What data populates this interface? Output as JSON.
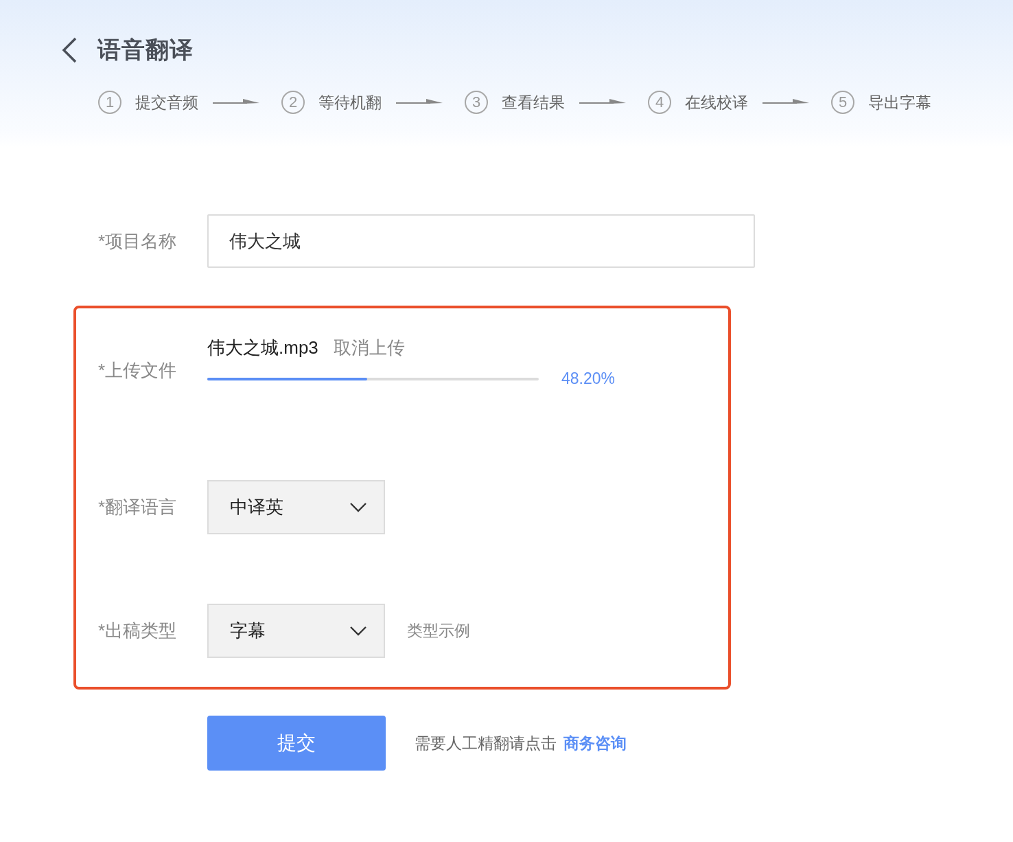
{
  "header": {
    "title": "语音翻译"
  },
  "steps": [
    {
      "number": "1",
      "label": "提交音频"
    },
    {
      "number": "2",
      "label": "等待机翻"
    },
    {
      "number": "3",
      "label": "查看结果"
    },
    {
      "number": "4",
      "label": "在线校译"
    },
    {
      "number": "5",
      "label": "导出字幕"
    }
  ],
  "project_name": {
    "label": "*项目名称",
    "value": "伟大之城"
  },
  "upload": {
    "label": "*上传文件",
    "file_name": "伟大之城.mp3",
    "cancel": "取消上传",
    "level": 0.482,
    "percent": "48.20%"
  },
  "language": {
    "label": "*翻译语言",
    "value": "中译英"
  },
  "output_type": {
    "label": "*出稿类型",
    "value": "字幕",
    "example_link": "类型示例"
  },
  "submit": {
    "label": "提交",
    "hint": "需要人工精翻请点击",
    "link": "商务咨询"
  }
}
